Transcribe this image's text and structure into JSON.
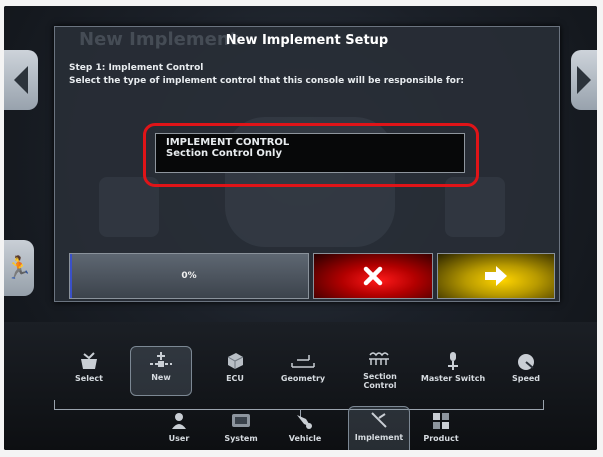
{
  "dialog": {
    "background_title": "New Implement",
    "title": "New Implement Setup",
    "step": "Step 1: Implement Control",
    "instruction": "Select the type of implement control that this console will be responsible for:",
    "select": {
      "label": "IMPLEMENT CONTROL",
      "value": "Section Control Only"
    },
    "progress": {
      "value": 0,
      "text": "0%"
    },
    "cancel_icon": "x-icon",
    "next_icon": "arrow-right-icon"
  },
  "side_nav": {
    "left_icon": "chevron-left-icon",
    "right_icon": "chevron-right-icon",
    "run_icon": "running-person-icon"
  },
  "implement_menu": [
    {
      "label": "Select",
      "icon": "select-icon"
    },
    {
      "label": "New",
      "icon": "new-implement-icon",
      "active": true
    },
    {
      "label": "ECU",
      "icon": "ecu-icon"
    },
    {
      "label": "Geometry",
      "icon": "geometry-icon"
    },
    {
      "label": "Section Control",
      "icon": "section-control-icon"
    },
    {
      "label": "Master Switch",
      "icon": "master-switch-icon"
    },
    {
      "label": "Speed",
      "icon": "speed-icon"
    }
  ],
  "main_menu": [
    {
      "label": "User",
      "icon": "user-icon"
    },
    {
      "label": "System",
      "icon": "system-icon"
    },
    {
      "label": "Vehicle",
      "icon": "vehicle-icon"
    },
    {
      "label": "Implement",
      "icon": "implement-icon",
      "active": true
    },
    {
      "label": "Product",
      "icon": "product-icon"
    }
  ],
  "colors": {
    "highlight": "#e01418",
    "cancel": "#d40000",
    "next": "#e5c000",
    "progress_fill": "#3a50c8"
  }
}
